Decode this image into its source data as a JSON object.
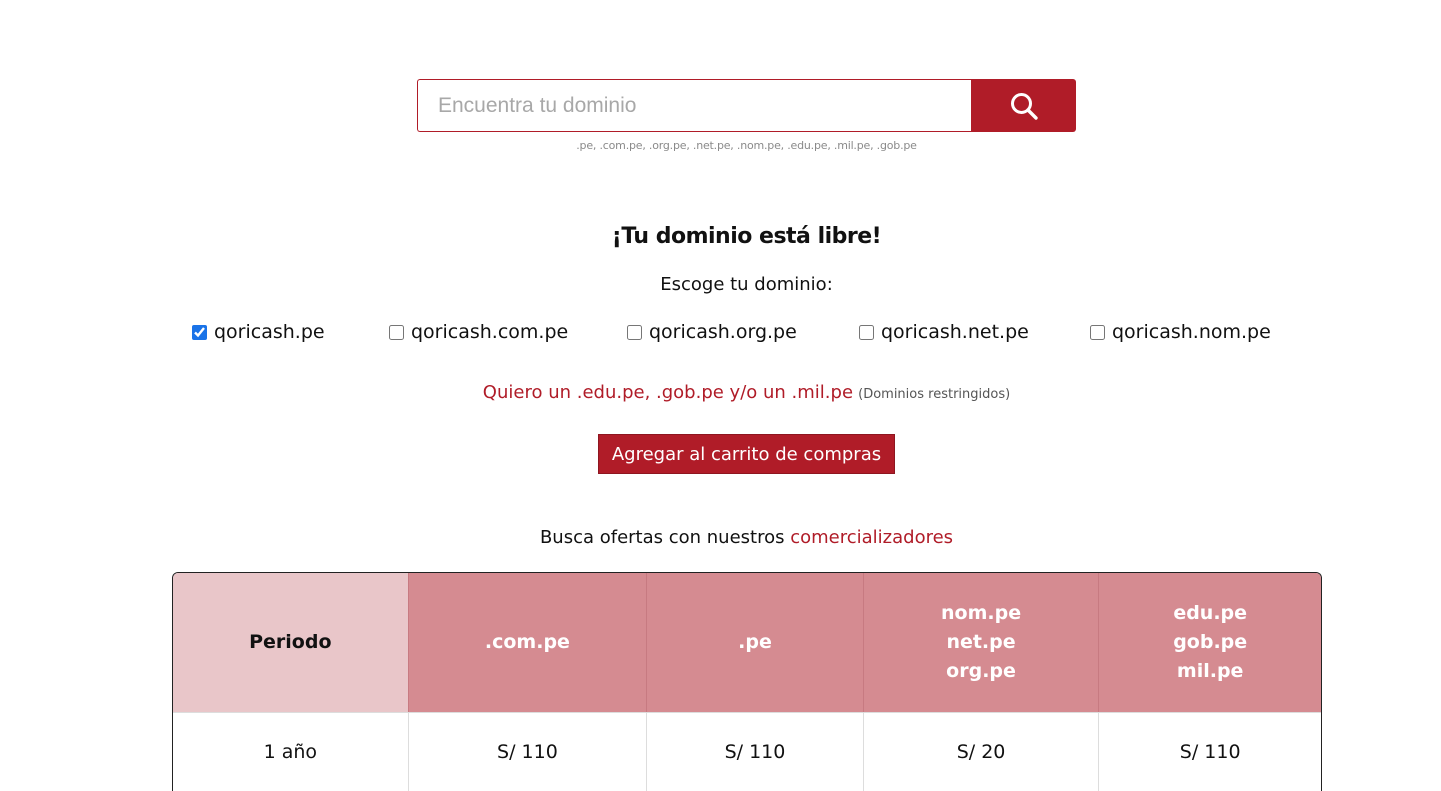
{
  "search": {
    "placeholder": "Encuentra tu dominio",
    "value": "",
    "button_icon": "search-icon",
    "hint": ".pe, .com.pe, .org.pe, .net.pe, .nom.pe, .edu.pe, .mil.pe, .gob.pe"
  },
  "result": {
    "title": "¡Tu dominio está libre!",
    "choose_label": "Escoge tu dominio:",
    "options": [
      {
        "label": "qoricash.pe",
        "checked": true
      },
      {
        "label": "qoricash.com.pe",
        "checked": false
      },
      {
        "label": "qoricash.org.pe",
        "checked": false
      },
      {
        "label": "qoricash.net.pe",
        "checked": false
      },
      {
        "label": "qoricash.nom.pe",
        "checked": false
      }
    ],
    "restricted_link": "Quiero un .edu.pe, .gob.pe y/o un .mil.pe",
    "restricted_note": "(Dominios restringidos)",
    "cart_button": "Agregar al carrito de compras"
  },
  "offers": {
    "text": "Busca ofertas con nuestros",
    "link": "comercializadores"
  },
  "table": {
    "headers": {
      "period": "Periodo",
      "compe": ".com.pe",
      "pe": ".pe",
      "group1": [
        "nom.pe",
        "net.pe",
        "org.pe"
      ],
      "group2": [
        "edu.pe",
        "gob.pe",
        "mil.pe"
      ]
    },
    "rows": [
      {
        "period": "1 año",
        "values": [
          "S/ 110",
          "S/ 110",
          "S/ 20",
          "S/ 110"
        ]
      }
    ]
  },
  "colors": {
    "brand_red": "#b01c28",
    "header_pink": "#d58b91",
    "header_light": "#e9c6c9"
  }
}
